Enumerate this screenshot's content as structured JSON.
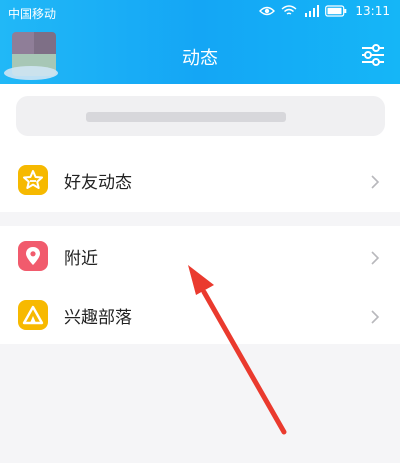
{
  "status_bar": {
    "carrier": "中国移动",
    "time": "13:11",
    "icons": [
      "eye-icon",
      "wifi-icon",
      "signal-icon",
      "battery-icon"
    ]
  },
  "header": {
    "title": "动态",
    "settings_icon": "settings-sliders-icon",
    "background": "#17aff6"
  },
  "menu": {
    "items": [
      {
        "label": "好友动态",
        "icon": "star-icon",
        "icon_color": "#f6b900"
      },
      {
        "label": "附近",
        "icon": "location-pin-icon",
        "icon_color": "#f15b6d"
      },
      {
        "label": "兴趣部落",
        "icon": "tribe-triangle-icon",
        "icon_color": "#f7b900"
      }
    ]
  },
  "annotation": {
    "arrow_color": "#ea3a2e"
  }
}
